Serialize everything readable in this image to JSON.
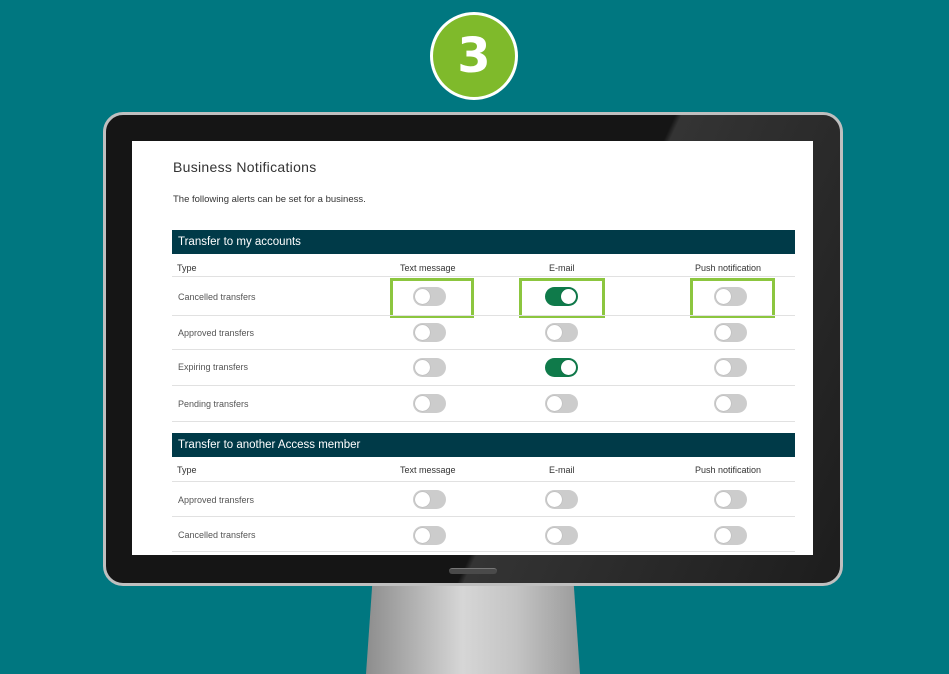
{
  "step_number": "3",
  "colors": {
    "background": "#007780",
    "badge": "#7fba2b",
    "section_header": "#003a48",
    "toggle_on": "#0f7a4a",
    "toggle_off": "#cccccc",
    "highlight": "#8cc63f"
  },
  "page": {
    "title": "Business Notifications",
    "intro": "The following alerts can be set for a business."
  },
  "sections": [
    {
      "title": "Transfer to my accounts",
      "columns": [
        "Type",
        "Text message",
        "E-mail",
        "Push notification"
      ],
      "rows": [
        {
          "label": "Cancelled transfers",
          "text": false,
          "email": true,
          "push": false
        },
        {
          "label": "Approved transfers",
          "text": false,
          "email": false,
          "push": false
        },
        {
          "label": "Expiring transfers",
          "text": false,
          "email": true,
          "push": false
        },
        {
          "label": "Pending transfers",
          "text": false,
          "email": false,
          "push": false
        }
      ]
    },
    {
      "title": "Transfer to another Access member",
      "columns": [
        "Type",
        "Text message",
        "E-mail",
        "Push notification"
      ],
      "rows": [
        {
          "label": "Approved transfers",
          "text": false,
          "email": false,
          "push": false
        },
        {
          "label": "Cancelled transfers",
          "text": false,
          "email": false,
          "push": false
        }
      ]
    }
  ]
}
